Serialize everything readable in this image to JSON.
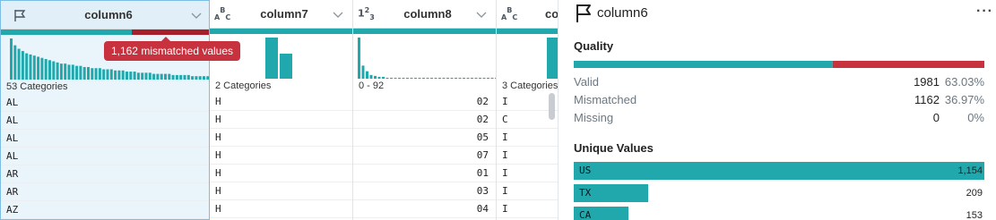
{
  "columns": [
    {
      "name": "column6",
      "type_icon": "flag-icon",
      "summary": "53 Categories",
      "quality": {
        "valid": 0.63,
        "mismatched": 0.37
      },
      "histogram": [
        36,
        30,
        27,
        25,
        23,
        22,
        21,
        20,
        19,
        18,
        17,
        16,
        15,
        14,
        14,
        13,
        13,
        12,
        12,
        11,
        11,
        10,
        10,
        10,
        9,
        9,
        9,
        8,
        8,
        8,
        7,
        7,
        7,
        6,
        6,
        6,
        6,
        5,
        5,
        5,
        5,
        5,
        4,
        4,
        4,
        4,
        4,
        3,
        3,
        3,
        3,
        3,
        3
      ],
      "cells": [
        "AL",
        "AL",
        "AL",
        "AL",
        "AR",
        "AR",
        "AZ"
      ]
    },
    {
      "name": "column7",
      "type_icon": "text-type-icon",
      "type_text": {
        "a": "A",
        "b": "B",
        "c": "C"
      },
      "summary": "2 Categories",
      "quality": {
        "valid": 1.0,
        "mismatched": 0
      },
      "histogram": [
        46,
        28
      ],
      "cells": [
        "H",
        "H",
        "H",
        "H",
        "H",
        "H",
        "H"
      ]
    },
    {
      "name": "column8",
      "type_icon": "number-type-icon",
      "type_text": {
        "a": "1",
        "b": "2",
        "c": "3"
      },
      "summary": "0 - 92",
      "quality": {
        "valid": 1.0,
        "mismatched": 0
      },
      "histogram": [
        44,
        14,
        8,
        4,
        3,
        2,
        2,
        1,
        1,
        1,
        1,
        1,
        1,
        1,
        1,
        1,
        1,
        1,
        1,
        1,
        1,
        1,
        1,
        1,
        1,
        1,
        1,
        1,
        1,
        1,
        1,
        1,
        1,
        1,
        1,
        1,
        1,
        1,
        1
      ],
      "cells": [
        "02",
        "02",
        "05",
        "07",
        "01",
        "03",
        "04"
      ]
    },
    {
      "name": "co",
      "type_icon": "text-type-icon",
      "type_text": {
        "a": "A",
        "b": "B",
        "c": "C"
      },
      "summary": "3 Categories",
      "quality": {
        "valid": 1.0,
        "mismatched": 0
      },
      "histogram": [
        46
      ],
      "cells": [
        "I",
        "C",
        "I",
        "I",
        "I",
        "I",
        "I"
      ]
    }
  ],
  "tooltip": "1,162 mismatched values",
  "colors": {
    "valid": "#21a8ad",
    "mismatched": "#c8313e",
    "missing": "#cfd4d8"
  },
  "panel": {
    "title": "column6",
    "title_icon": "flag-icon",
    "menu_icon": "more-options-icon",
    "menu_glyph": "···",
    "quality": {
      "heading": "Quality",
      "valid_fraction": 0.6303,
      "rows": [
        {
          "label": "Valid",
          "count": "1981",
          "pct": "63.03%"
        },
        {
          "label": "Mismatched",
          "count": "1162",
          "pct": "36.97%"
        },
        {
          "label": "Missing",
          "count": "0",
          "pct": "0%"
        }
      ]
    },
    "unique": {
      "heading": "Unique Values",
      "rows": [
        {
          "label": "US",
          "count": "1,154",
          "value": 1154
        },
        {
          "label": "TX",
          "count": "209",
          "value": 209
        },
        {
          "label": "CA",
          "count": "153",
          "value": 153
        }
      ]
    }
  }
}
